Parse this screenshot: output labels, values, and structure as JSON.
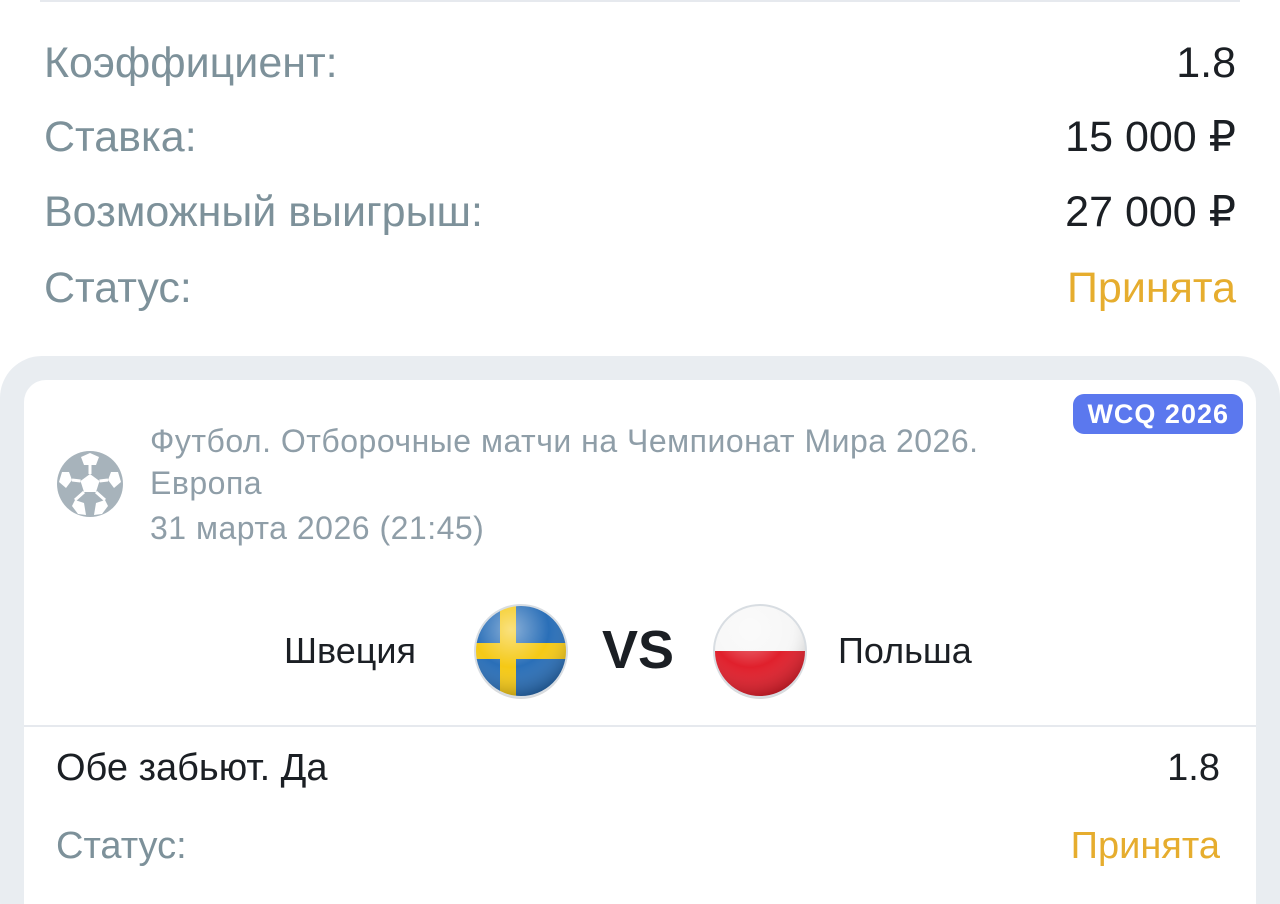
{
  "summary": {
    "odds_label": "Коэффициент:",
    "odds_value": "1.8",
    "stake_label": "Ставка:",
    "stake_value": "15 000 ₽",
    "payout_label": "Возможный выигрыш:",
    "payout_value": "27 000 ₽",
    "status_label": "Статус:",
    "status_value": "Принята"
  },
  "event": {
    "badge": "WCQ 2026",
    "sport_icon": "soccer-ball-icon",
    "league": "Футбол. Отборочные матчи на Чемпионат Мира 2026. Европа",
    "date": "31 марта 2026 (21:45)",
    "home_team": "Швеция",
    "home_flag": "sweden-flag-icon",
    "vs": "VS",
    "away_team": "Польша",
    "away_flag": "poland-flag-icon"
  },
  "bet": {
    "market": "Обе забьют. Да",
    "odds": "1.8",
    "status_label": "Статус:",
    "status_value": "Принята"
  },
  "colors": {
    "accepted": "#e6ad2e",
    "label_gray": "#7d919a",
    "badge_blue": "#5b78ee",
    "card_bg": "#e9edf1"
  }
}
